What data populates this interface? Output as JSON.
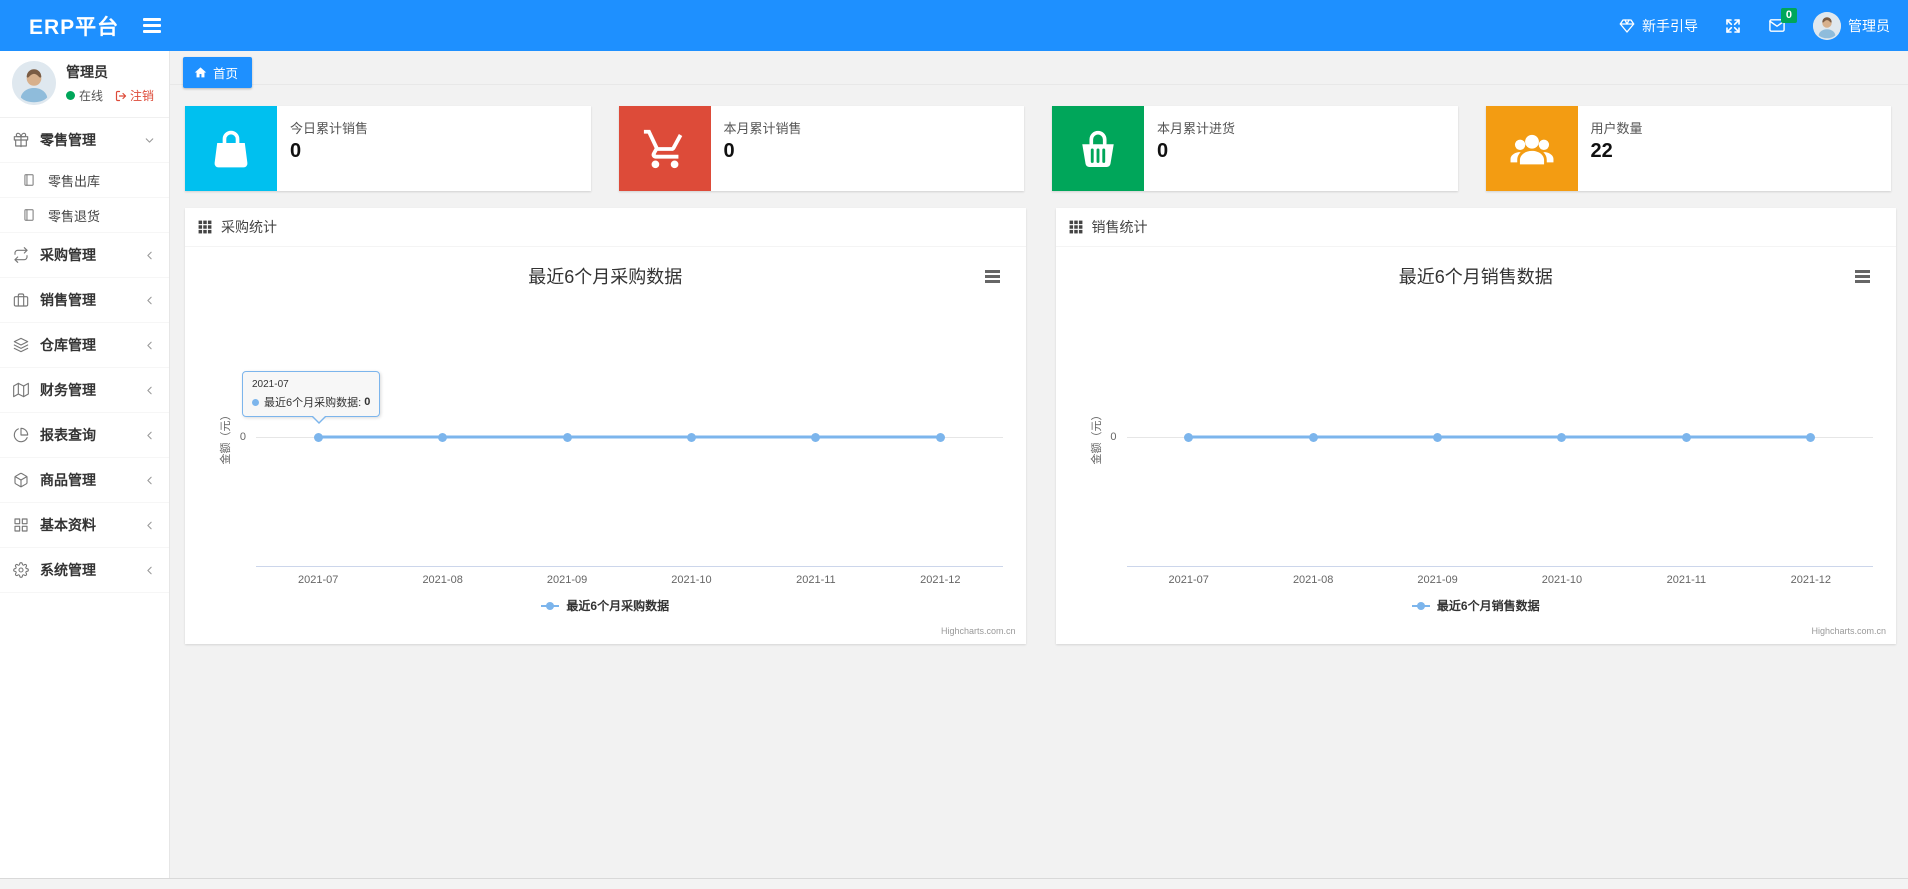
{
  "navbar": {
    "brand": "ERP平台",
    "menu_toggle_icon": "hamburger-icon",
    "guide": {
      "icon": "gem-icon",
      "label": "新手引导"
    },
    "fullscreen_icon": "fullscreen-icon",
    "mail": {
      "icon": "envelope-icon",
      "badge": "0",
      "badge_color": "#00a65a"
    },
    "user": {
      "avatar_icon": "avatar",
      "name": "管理员"
    },
    "color": "#1e90ff"
  },
  "sidebar": {
    "user": {
      "avatar_icon": "avatar",
      "name": "管理员",
      "status": "在线",
      "status_dot_color": "#00a65a",
      "logout": "注销",
      "logout_icon": "sign-out-icon",
      "logout_color": "#dd4b39"
    },
    "menu": [
      {
        "icon": "gift-icon",
        "label": "零售管理",
        "chevron": "down",
        "expanded": true,
        "children": [
          {
            "icon": "doc-icon",
            "label": "零售出库"
          },
          {
            "icon": "doc-icon",
            "label": "零售退货"
          }
        ]
      },
      {
        "icon": "repeat-icon",
        "label": "采购管理",
        "chevron": "left"
      },
      {
        "icon": "briefcase-icon",
        "label": "销售管理",
        "chevron": "left"
      },
      {
        "icon": "layers-icon",
        "label": "仓库管理",
        "chevron": "left"
      },
      {
        "icon": "map-book-icon",
        "label": "财务管理",
        "chevron": "left"
      },
      {
        "icon": "pie-chart-icon",
        "label": "报表查询",
        "chevron": "left"
      },
      {
        "icon": "package-icon",
        "label": "商品管理",
        "chevron": "left"
      },
      {
        "icon": "grid-icon",
        "label": "基本资料",
        "chevron": "left"
      },
      {
        "icon": "gear-icon",
        "label": "系统管理",
        "chevron": "left"
      }
    ]
  },
  "tabs": [
    {
      "icon": "home-icon",
      "label": "首页",
      "active": true,
      "color": "#1e90ff"
    }
  ],
  "stat_cards": [
    {
      "icon": "shopping-bag-icon",
      "color": "#00c0ef",
      "label": "今日累计销售",
      "value": "0"
    },
    {
      "icon": "shopping-cart-icon",
      "color": "#dd4b39",
      "label": "本月累计销售",
      "value": "0"
    },
    {
      "icon": "shopping-basket-icon",
      "color": "#00a65a",
      "label": "本月累计进货",
      "value": "0"
    },
    {
      "icon": "users-icon",
      "color": "#f39c12",
      "label": "用户数量",
      "value": "22"
    }
  ],
  "panels": [
    {
      "icon": "th-grid-icon",
      "title": "采购统计"
    },
    {
      "icon": "th-grid-icon",
      "title": "销售统计"
    }
  ],
  "chart_data": [
    {
      "type": "line",
      "title": "最近6个月采购数据",
      "categories": [
        "2021-07",
        "2021-08",
        "2021-09",
        "2021-10",
        "2021-11",
        "2021-12"
      ],
      "series": [
        {
          "name": "最近6个月采购数据",
          "color": "#7cb5ec",
          "values": [
            0,
            0,
            0,
            0,
            0,
            0
          ]
        }
      ],
      "ylabel": "金额（元）",
      "yticks": [
        "0"
      ],
      "legend_position": "bottom",
      "grid": "zero-line-only",
      "credit": "Highcharts.com.cn",
      "tooltip": {
        "visible": true,
        "category": "2021-07",
        "text": "最近6个月采购数据: ",
        "value": "0"
      }
    },
    {
      "type": "line",
      "title": "最近6个月销售数据",
      "categories": [
        "2021-07",
        "2021-08",
        "2021-09",
        "2021-10",
        "2021-11",
        "2021-12"
      ],
      "series": [
        {
          "name": "最近6个月销售数据",
          "color": "#7cb5ec",
          "values": [
            0,
            0,
            0,
            0,
            0,
            0
          ]
        }
      ],
      "ylabel": "金额（元）",
      "yticks": [
        "0"
      ],
      "legend_position": "bottom",
      "grid": "zero-line-only",
      "credit": "Highcharts.com.cn",
      "tooltip": {
        "visible": false
      }
    }
  ]
}
